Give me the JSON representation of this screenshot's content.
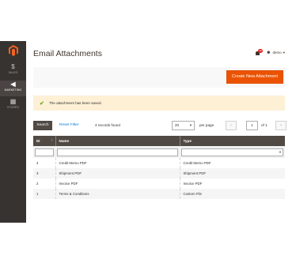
{
  "sidebar": {
    "logo": "magento-logo-icon",
    "items": [
      {
        "label": "SALES",
        "icon": "$"
      },
      {
        "label": "MARKETING",
        "icon": "◀"
      },
      {
        "label": "STORES",
        "icon": "▦"
      }
    ]
  },
  "header": {
    "title": "Email Attachments",
    "notifications_count": "10",
    "user": "demo"
  },
  "actions": {
    "create_label": "Create New Attachment"
  },
  "message": {
    "text": "The attachment has been saved."
  },
  "toolbar": {
    "search_label": "Search",
    "reset_label": "Reset Filter",
    "records": "4 records found",
    "per_page_value": "20",
    "per_page_label": "per page",
    "page_prev": "‹",
    "page_value": "1",
    "page_total": "of 1",
    "page_next": "›"
  },
  "grid": {
    "columns": [
      "ID",
      "Name",
      "Type"
    ],
    "rows": [
      {
        "id": "4",
        "name": "Credit Memo PDF",
        "type": "Credit Memo PDF"
      },
      {
        "id": "3",
        "name": "Shipment PDF",
        "type": "Shipment PDF"
      },
      {
        "id": "2",
        "name": "Invoice PDF",
        "type": "Invoice PDF"
      },
      {
        "id": "1",
        "name": "Terms & Conditions",
        "type": "Custom File"
      }
    ]
  },
  "colors": {
    "accent": "#eb5202",
    "sidebar": "#373330",
    "header_row": "#514943",
    "success": "#79a22e",
    "message_bg": "#fdf0d5"
  }
}
